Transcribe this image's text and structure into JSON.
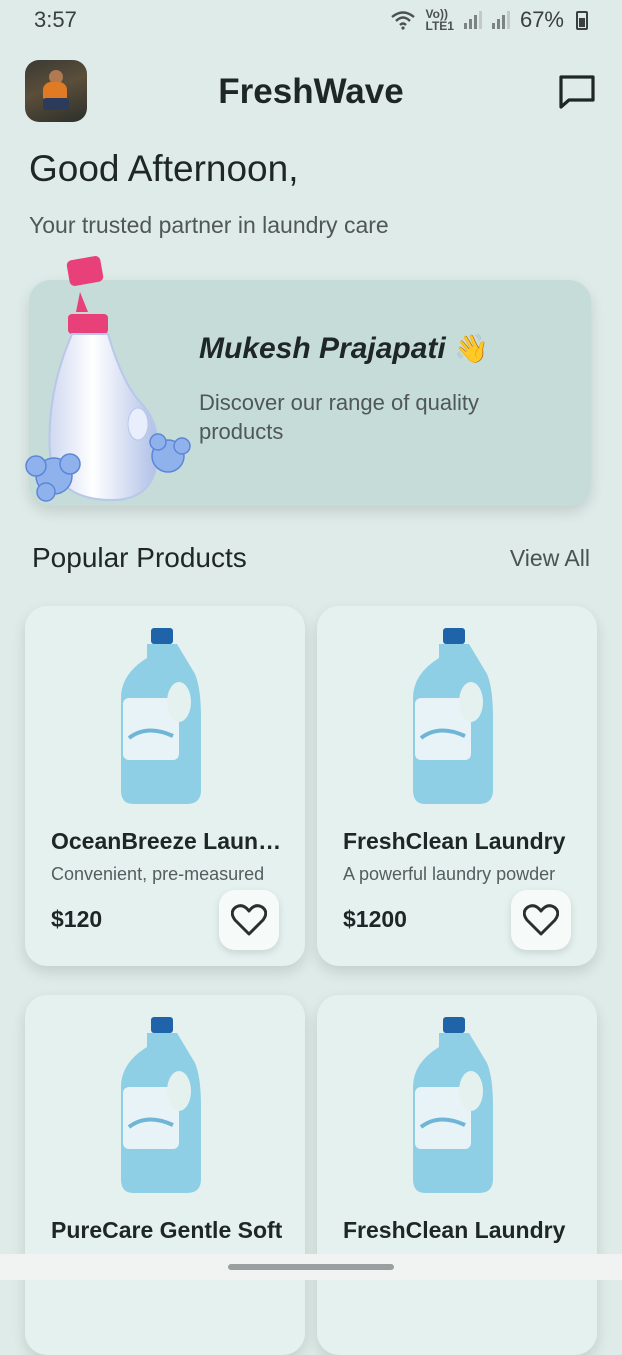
{
  "status_bar": {
    "time": "3:57",
    "network_label_top": "Vo))",
    "network_label_bottom": "LTE1",
    "battery": "67%",
    "icons": [
      "wifi-icon",
      "signal-icon",
      "signal-icon",
      "battery-icon"
    ]
  },
  "header": {
    "title": "FreshWave",
    "avatar_icon": "user-avatar",
    "action_icon": "chat-icon"
  },
  "greeting": {
    "title": "Good Afternoon,",
    "subtitle": "Your trusted partner in laundry care"
  },
  "hero": {
    "name": "Mukesh Prajapati",
    "emoji": "👋",
    "subtitle": "Discover our range of quality products",
    "image_icon": "detergent-bottle-with-flowers"
  },
  "popular": {
    "title": "Popular Products",
    "view_all": "View All",
    "products": [
      {
        "name": "OceanBreeze Laundry",
        "description": "Convenient, pre-measured",
        "price": "$120",
        "favorite_icon": "heart-icon"
      },
      {
        "name": "FreshClean Laundry",
        "description": "A powerful laundry powder",
        "price": "$1200",
        "favorite_icon": "heart-icon"
      },
      {
        "name": "PureCare Gentle Soft",
        "description": "",
        "price": "",
        "favorite_icon": "heart-icon"
      },
      {
        "name": "FreshClean Laundry",
        "description": "",
        "price": "",
        "favorite_icon": "heart-icon"
      }
    ]
  },
  "colors": {
    "background": "#deebe8",
    "hero_card": "#c6dcd8",
    "product_card": "#e4f1ef",
    "bottle_blue": "#8ecfe6",
    "cap_pink": "#e8417a"
  }
}
